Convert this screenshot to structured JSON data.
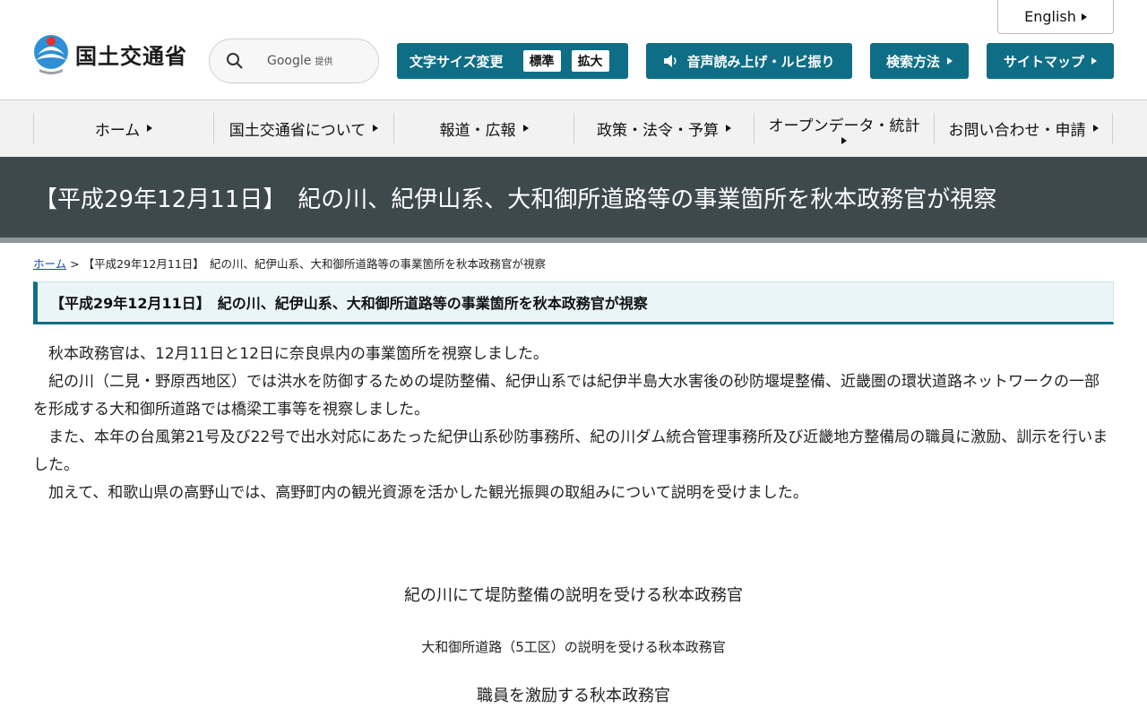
{
  "header": {
    "english_label": "English",
    "logo_text": "国土交通省",
    "search": {
      "placeholder": "Google",
      "provided": "提供"
    },
    "font_size": {
      "label": "文字サイズ変更",
      "standard": "標準",
      "enlarge": "拡大"
    },
    "voice_label": "音声読み上げ・ルビ振り",
    "search_method_label": "検索方法",
    "sitemap_label": "サイトマップ"
  },
  "nav": {
    "items": [
      {
        "label": "ホーム"
      },
      {
        "label": "国土交通省について"
      },
      {
        "label": "報道・広報"
      },
      {
        "label": "政策・法令・予算"
      },
      {
        "label": "オープンデータ・統計"
      },
      {
        "label": "お問い合わせ・申請"
      }
    ]
  },
  "page": {
    "title": "【平成29年12月11日】　紀の川、紀伊山系、大和御所道路等の事業箇所を秋本政務官が視察",
    "breadcrumb": {
      "home": "ホーム",
      "separator": " > ",
      "current": "【平成29年12月11日】　紀の川、紀伊山系、大和御所道路等の事業箇所を秋本政務官が視察"
    },
    "section_heading": "【平成29年12月11日】　紀の川、紀伊山系、大和御所道路等の事業箇所を秋本政務官が視察",
    "paragraphs": [
      "　秋本政務官は、12月11日と12日に奈良県内の事業箇所を視察しました。",
      "　紀の川（二見・野原西地区）では洪水を防御するための堤防整備、紀伊山系では紀伊半島大水害後の砂防堰堤整備、近畿圏の環状道路ネットワークの一部を形成する大和御所道路では橋梁工事等を視察しました。",
      "　また、本年の台風第21号及び22号で出水対応にあたった紀伊山系砂防事務所、紀の川ダム統合管理事務所及び近畿地方整備局の職員に激励、訓示を行いました。",
      "　加えて、和歌山県の高野山では、高野町内の観光資源を活かした観光振興の取組みについて説明を受けました。"
    ],
    "captions": [
      "紀の川にて堤防整備の説明を受ける秋本政務官",
      "大和御所道路（5工区）の説明を受ける秋本政務官",
      "職員を激励する秋本政務官"
    ]
  },
  "colors": {
    "accent": "#0e6e86",
    "title_band": "#3d494d",
    "nav_bg": "#f2f2f2"
  }
}
